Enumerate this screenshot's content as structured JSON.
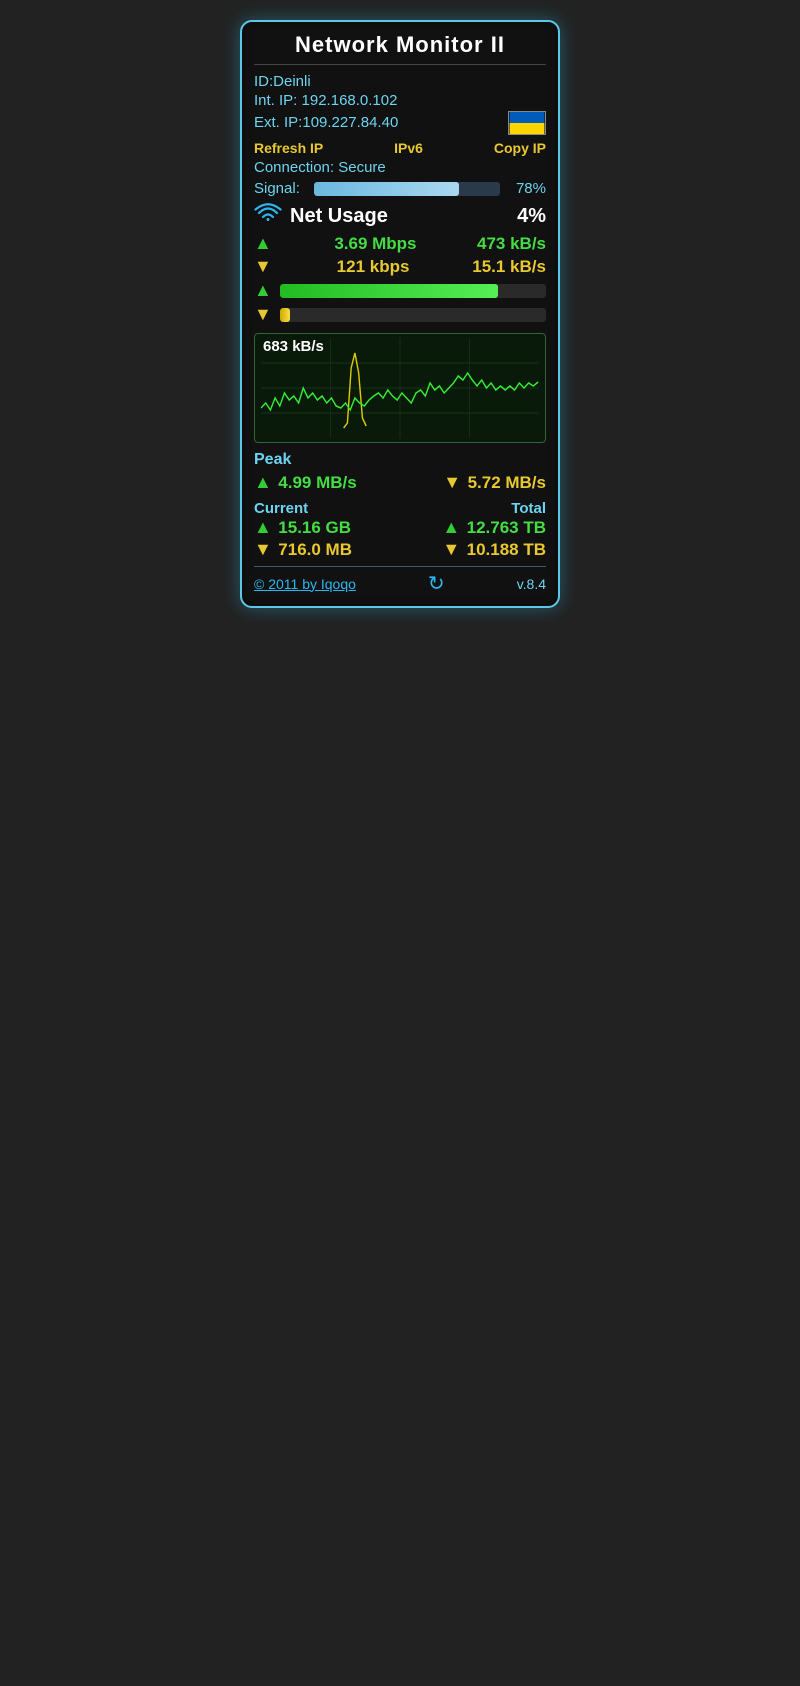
{
  "widget": {
    "title": "Network Monitor II",
    "id_label": "ID:",
    "id_value": "Deinli",
    "int_ip_label": "Int. IP:",
    "int_ip_value": "192.168.0.102",
    "ext_ip_label": "Ext. IP:",
    "ext_ip_value": "109.227.84.40",
    "refresh_btn": "Refresh IP",
    "ipv6_btn": "IPv6",
    "copy_btn": "Copy IP",
    "connection_label": "Connection:",
    "connection_value": "Secure",
    "signal_label": "Signal:",
    "signal_pct": "78%",
    "signal_value": 78,
    "net_usage_label": "Net Usage",
    "net_usage_pct": "4%",
    "upload_speed": "3.69 Mbps",
    "upload_speed_kb": "473 kB/s",
    "download_speed": "121 kbps",
    "download_speed_kb": "15.1 kB/s",
    "upload_bar_pct": 82,
    "download_bar_pct": 4,
    "chart_label": "683 kB/s",
    "peak_label": "Peak",
    "peak_up": "4.99 MB/s",
    "peak_down": "5.72 MB/s",
    "current_label": "Current",
    "total_label": "Total",
    "current_up": "15.16 GB",
    "current_down": "716.0 MB",
    "total_up": "12.763 TB",
    "total_down": "10.188 TB",
    "footer_link": "© 2011 by Iqoqo",
    "version": "v.8.4"
  }
}
